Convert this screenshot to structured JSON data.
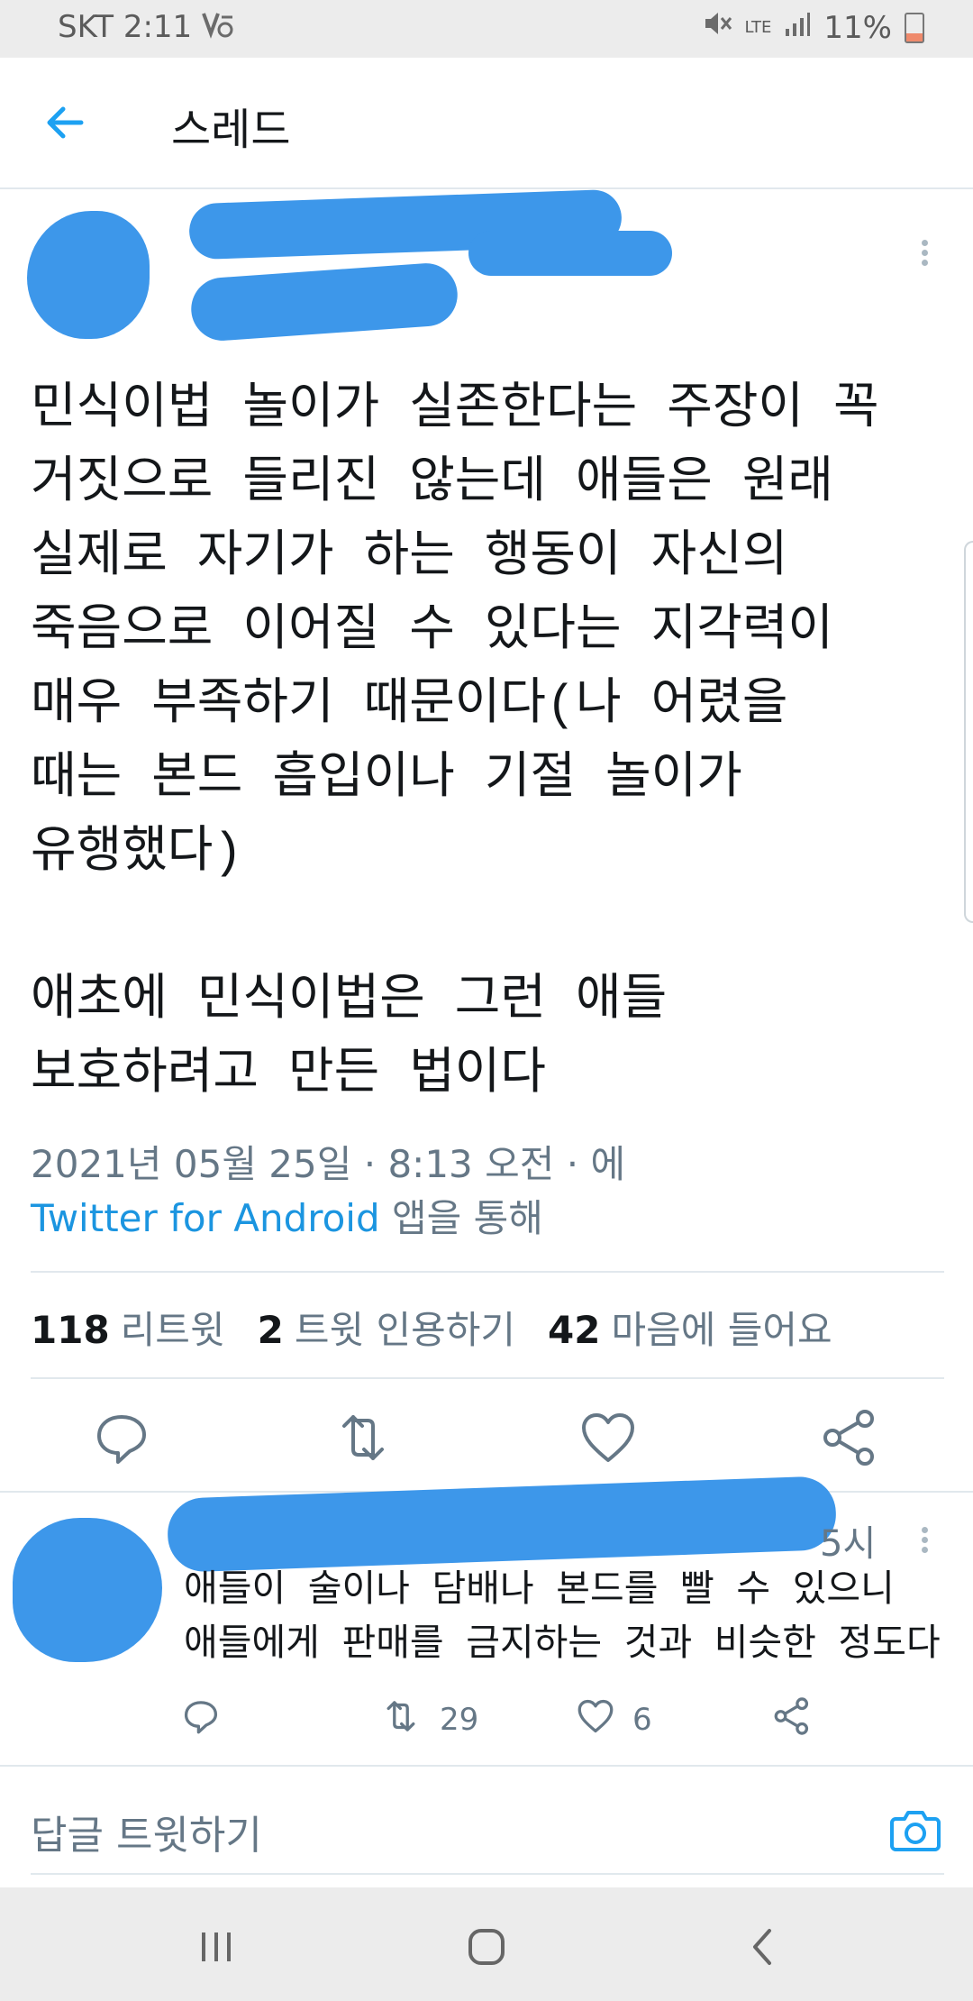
{
  "status_bar": {
    "carrier_time": "SKT 2:11",
    "network": "LTE",
    "battery": "11%"
  },
  "app_bar": {
    "back_icon": "arrow-left-icon",
    "title": "스레드"
  },
  "tweet": {
    "body": "민식이법 놀이가 실존한다는 주장이 꼭\n거짓으로 들리진 않는데 애들은 원래\n실제로 자기가 하는 행동이 자신의\n죽음으로 이어질 수 있다는 지각력이\n매우 부족하기 때문이다(나 어렸을\n때는 본드 흡입이나 기절 놀이가\n유행했다)\n\n애초에 민식이법은 그런 애들\n보호하려고 만든 법이다",
    "date": "2021년 05월 25일 · 8:13 오전 · 에",
    "source": "Twitter for Android",
    "source_suffix": " 앱을 통해",
    "stats": {
      "retweets_count": "118",
      "retweets_label": "리트윗",
      "quotes_count": "2",
      "quotes_label": "트윗 인용하기",
      "likes_count": "42",
      "likes_label": "마음에 들어요"
    },
    "actions": [
      "reply-icon",
      "retweet-icon",
      "heart-icon",
      "share-icon"
    ]
  },
  "reply": {
    "time": "5시",
    "text": "애들이 술이나 담배나 본드를 빨 수 있으니\n애들에게 판매를 금지하는 것과 비슷한 정도다",
    "retweets": "29",
    "likes": "6"
  },
  "compose": {
    "placeholder": "답글 트윗하기",
    "camera_icon": "camera-icon"
  },
  "colors": {
    "accent": "#1b95e0",
    "redaction": "#3d97ea",
    "secondary_text": "#657786"
  }
}
